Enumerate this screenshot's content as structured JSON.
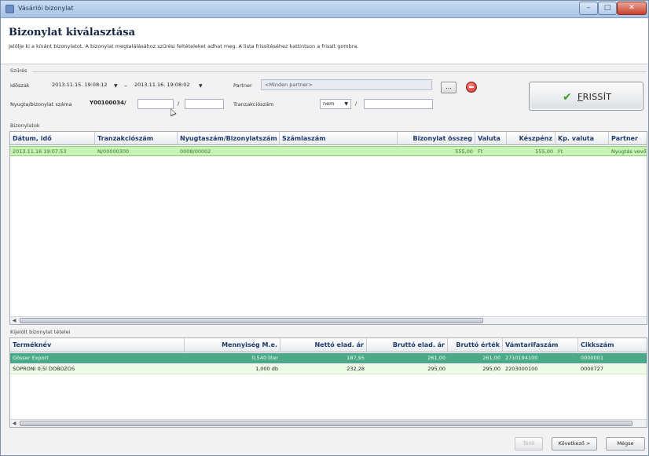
{
  "window": {
    "title": "Vásárlói bizonylat",
    "min": "–",
    "max": "□",
    "close": "✕"
  },
  "header": {
    "title": "Bizonylat kiválasztása",
    "description": "Jelölje ki a kívánt bizonylatot. A bizonylat megtalálásához szűrési feltételeket adhat meg. A lista frissítéséhez kattintson a frissít gombra."
  },
  "filter": {
    "group_label": "Szűrés",
    "idoszak_label": "Időszak",
    "date_from": "2013.11.15. 19:08:12",
    "date_sep": "–",
    "date_to": "2013.11.16. 19:08:02",
    "dropdown_arrow": "▼",
    "partner_label": "Partner",
    "partner_value": "<Minden partner>",
    "partner_btn": "...",
    "nyugta_label": "Nyugta/bizonylat száma",
    "nyugta_prefix": "Y00100034/",
    "nyugta_value": "",
    "slash": "/",
    "nyugta_value2": "",
    "tranz_label": "Tranzakciószám",
    "tranz_select": "nem",
    "tranz_value": "",
    "refresh_check": "✔",
    "refresh_label": "FRISSÍT"
  },
  "docs": {
    "group_label": "Bizonylatok",
    "columns": [
      "Dátum, idő",
      "Tranzakciószám",
      "Nyugtaszám/Bizonylatszám",
      "Számlaszám",
      "Bizonylat összeg",
      "Valuta",
      "Készpénz",
      "Kp. valuta",
      "Partner"
    ],
    "rows": [
      [
        "2013.11.16 19:07:53",
        "N/00000300",
        "0008/00002",
        "",
        "555,00",
        "Ft",
        "555,00",
        "Ft",
        "Nyugtás vevő"
      ]
    ]
  },
  "items": {
    "group_label": "Kijelölt bizonylat tételei",
    "columns": [
      "Terméknév",
      "Mennyiség M.e.",
      "Nettó elad. ár",
      "Bruttó elad. ár",
      "Bruttó érték",
      "Vámtarifaszám",
      "Cikkszám"
    ],
    "rows": [
      [
        "Gösser Export",
        "0,540 liter",
        "187,95",
        "261,00",
        "261,00",
        "2710194100",
        "0000001"
      ],
      [
        "SOPRONI 0,5l DOBOZOS",
        "1,000 db",
        "232,28",
        "295,00",
        "295,00",
        "2203000100",
        "0000727"
      ]
    ]
  },
  "footer": {
    "delete": "Töröl",
    "next": "Következő >",
    "cancel": "Mégse"
  }
}
